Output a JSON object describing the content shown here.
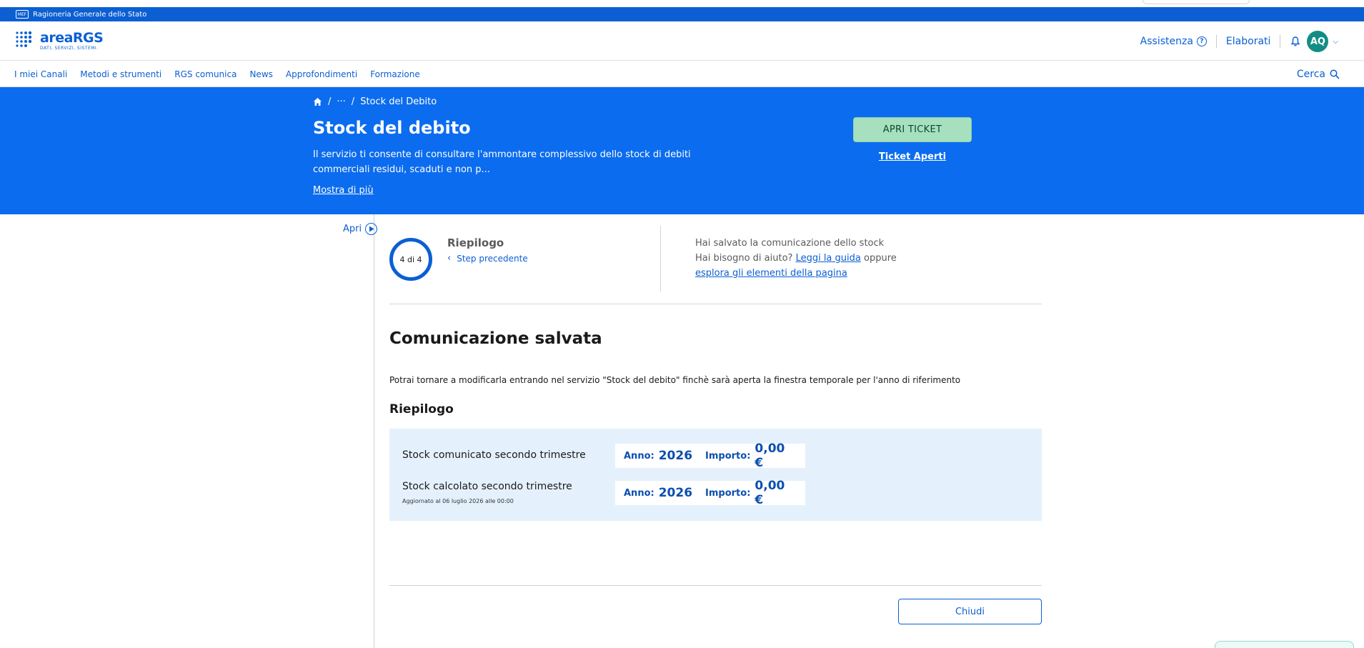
{
  "gov_bar": {
    "name": "Ragioneria Generale dello Stato",
    "logo_text": "MEF"
  },
  "header": {
    "logo_name": "areaRGS",
    "logo_tagline": "DATI, SERVIZI, SISTEMI.",
    "assistenza": "Assistenza",
    "elaborati": "Elaborati",
    "avatar_initials": "AQ"
  },
  "nav": {
    "items": [
      "I miei Canali",
      "Metodi e strumenti",
      "RGS comunica",
      "News",
      "Approfondimenti",
      "Formazione"
    ],
    "search_label": "Cerca"
  },
  "hero": {
    "breadcrumb_more": "···",
    "breadcrumb_current": "Stock del Debito",
    "title": "Stock del debito",
    "description": "Il servizio ti consente di consultare l'ammontare complessivo dello stock di debiti commerciali residui, scaduti e non p...",
    "show_more": "Mostra di più",
    "ticket_button": "APRI TICKET",
    "ticket_link": "Ticket Aperti"
  },
  "side": {
    "apri_label": "Apri"
  },
  "stepper": {
    "progress": "4 di 4",
    "current_step": 4,
    "total_steps": 4,
    "title": "Riepilogo",
    "back": "Step precedente"
  },
  "help": {
    "line1": "Hai salvato la comunicazione dello stock",
    "line2_prefix": "Hai bisogno di aiuto?",
    "guide_link": "Leggi la guida",
    "line2_suffix": "oppure",
    "explore_link": "esplora gli elementi della pagina"
  },
  "main": {
    "title": "Comunicazione salvata",
    "text": "Potrai tornare a modificarla entrando nel servizio \"Stock del debito\" finchè sarà aperta la finestra temporale per l'anno di riferimento",
    "summary_title": "Riepilogo",
    "rows": [
      {
        "label": "Stock comunicato secondo trimestre",
        "sub": "",
        "anno_label": "Anno:",
        "anno": "2026",
        "importo_label": "Importo:",
        "importo": "0,00 €"
      },
      {
        "label": "Stock calcolato secondo trimestre",
        "sub": "Aggiornato al 06 luglio 2026 alle 00:00",
        "anno_label": "Anno:",
        "anno": "2026",
        "importo_label": "Importo:",
        "importo": "0,00 €"
      }
    ],
    "close_button": "Chiudi"
  },
  "colors": {
    "brand_blue": "#0b5fd3",
    "hero_blue": "#0b6cef",
    "ticket_green": "#a6e0bf",
    "avatar_teal": "#118d86",
    "summary_bg": "#e4f1fd"
  },
  "icons": [
    "home-icon",
    "question-icon",
    "bell-icon",
    "chevron-down-icon",
    "search-icon",
    "play-circle-icon",
    "chevron-left-icon"
  ]
}
